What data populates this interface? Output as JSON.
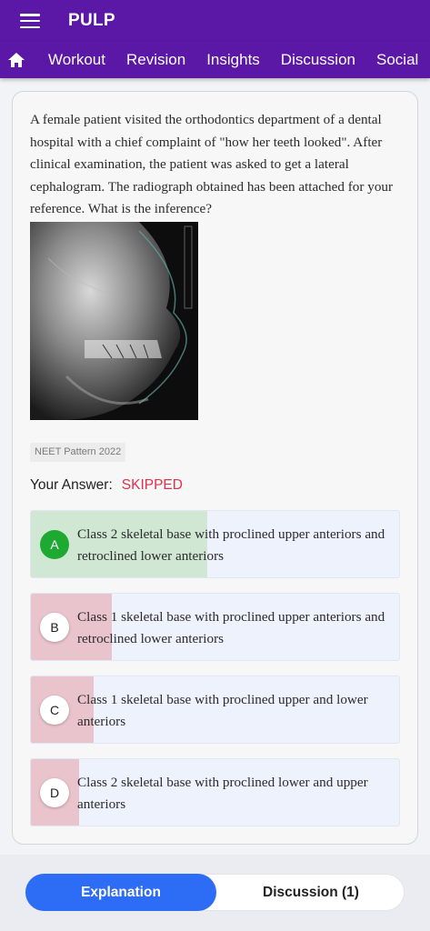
{
  "app": {
    "title": "PULP"
  },
  "icons": {
    "menu": "hamburger-menu-icon",
    "home": "home-icon"
  },
  "nav_tabs": [
    "Workout",
    "Revision",
    "Insights",
    "Discussion",
    "Social"
  ],
  "question": {
    "text": "A female patient visited the orthodontics department of a dental hospital with a chief complaint of \"how her teeth looked\". After clinical examination, the patient was asked to get a lateral cephalogram. The radiograph obtained has been attached for your reference. What is the inference?",
    "tag": "NEET Pattern 2022"
  },
  "answer": {
    "label": "Your Answer:",
    "value": "SKIPPED"
  },
  "options": [
    {
      "letter": "A",
      "text": "Class 2 skeletal base with proclined upper anteriors and retroclined lower anteriors",
      "correct": true,
      "percent": 48,
      "fill_color": "#cfe7d3"
    },
    {
      "letter": "B",
      "text": "Class 1 skeletal base with proclined upper anteriors and retroclined lower anteriors",
      "correct": false,
      "percent": 22,
      "fill_color": "#eac4cc"
    },
    {
      "letter": "C",
      "text": "Class 1 skeletal base with proclined upper and lower anteriors",
      "correct": false,
      "percent": 17,
      "fill_color": "#eac4cc"
    },
    {
      "letter": "D",
      "text": "Class 2 skeletal base with proclined lower and upper anteriors",
      "correct": false,
      "percent": 13,
      "fill_color": "#eac4cc"
    }
  ],
  "bottom": {
    "explanation_label": "Explanation",
    "discussion_label": "Discussion (1)"
  },
  "colors": {
    "appbar": "#5b17a6",
    "accent_blue": "#2d6cf5",
    "skipped_red": "#e0314c",
    "correct_green": "#1ea932"
  }
}
